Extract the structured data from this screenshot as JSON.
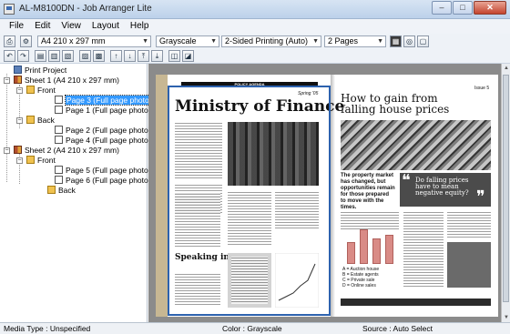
{
  "window": {
    "title": "AL-M8100DN - Job Arranger Lite",
    "buttons": {
      "minimize": "–",
      "maximize": "□",
      "close": "✕"
    }
  },
  "menu": [
    "File",
    "Edit",
    "View",
    "Layout",
    "Help"
  ],
  "toolbar": {
    "paper_size": "A4 210 x 297 mm",
    "color_mode": "Grayscale",
    "duplex": "2-Sided Printing (Auto)",
    "pages_per_sheet": "2 Pages"
  },
  "tree": {
    "project": "Print Project",
    "sheet1": "Sheet 1 (A4 210 x 297 mm)",
    "sheet1_front": "Front",
    "sheet1_front_p3": "Page 3 (Full page photo)",
    "sheet1_front_p1": "Page 1 (Full page photo)",
    "sheet1_back": "Back",
    "sheet1_back_p2": "Page 2 (Full page photo)",
    "sheet1_back_p4": "Page 4 (Full page photo)",
    "sheet2": "Sheet 2 (A4 210 x 297 mm)",
    "sheet2_front": "Front",
    "sheet2_front_p5": "Page 5 (Full page photo)",
    "sheet2_front_p6": "Page 6 (Full page photo)",
    "sheet2_back": "Back"
  },
  "preview": {
    "left_page": {
      "header": "POLICY AGENDA",
      "issue": "Spring '05",
      "headline": "Ministry of Finance",
      "subhead": "Speaking in $+e"
    },
    "right_page": {
      "issue": "Issue 5",
      "headline_line1": "How to gain from",
      "headline_line2": "falling house prices",
      "standfirst": "The property market has changed, but opportunities remain for those prepared to move with the times.",
      "pullquote": "Do falling prices have to mean negative equity?",
      "chart_legend": [
        "A = Auction house",
        "B = Estate agents",
        "C = Private sale",
        "D = Online sales"
      ]
    }
  },
  "status": {
    "media_type": "Media Type : Unspecified",
    "color": "Color : Grayscale",
    "source": "Source : Auto Select"
  }
}
